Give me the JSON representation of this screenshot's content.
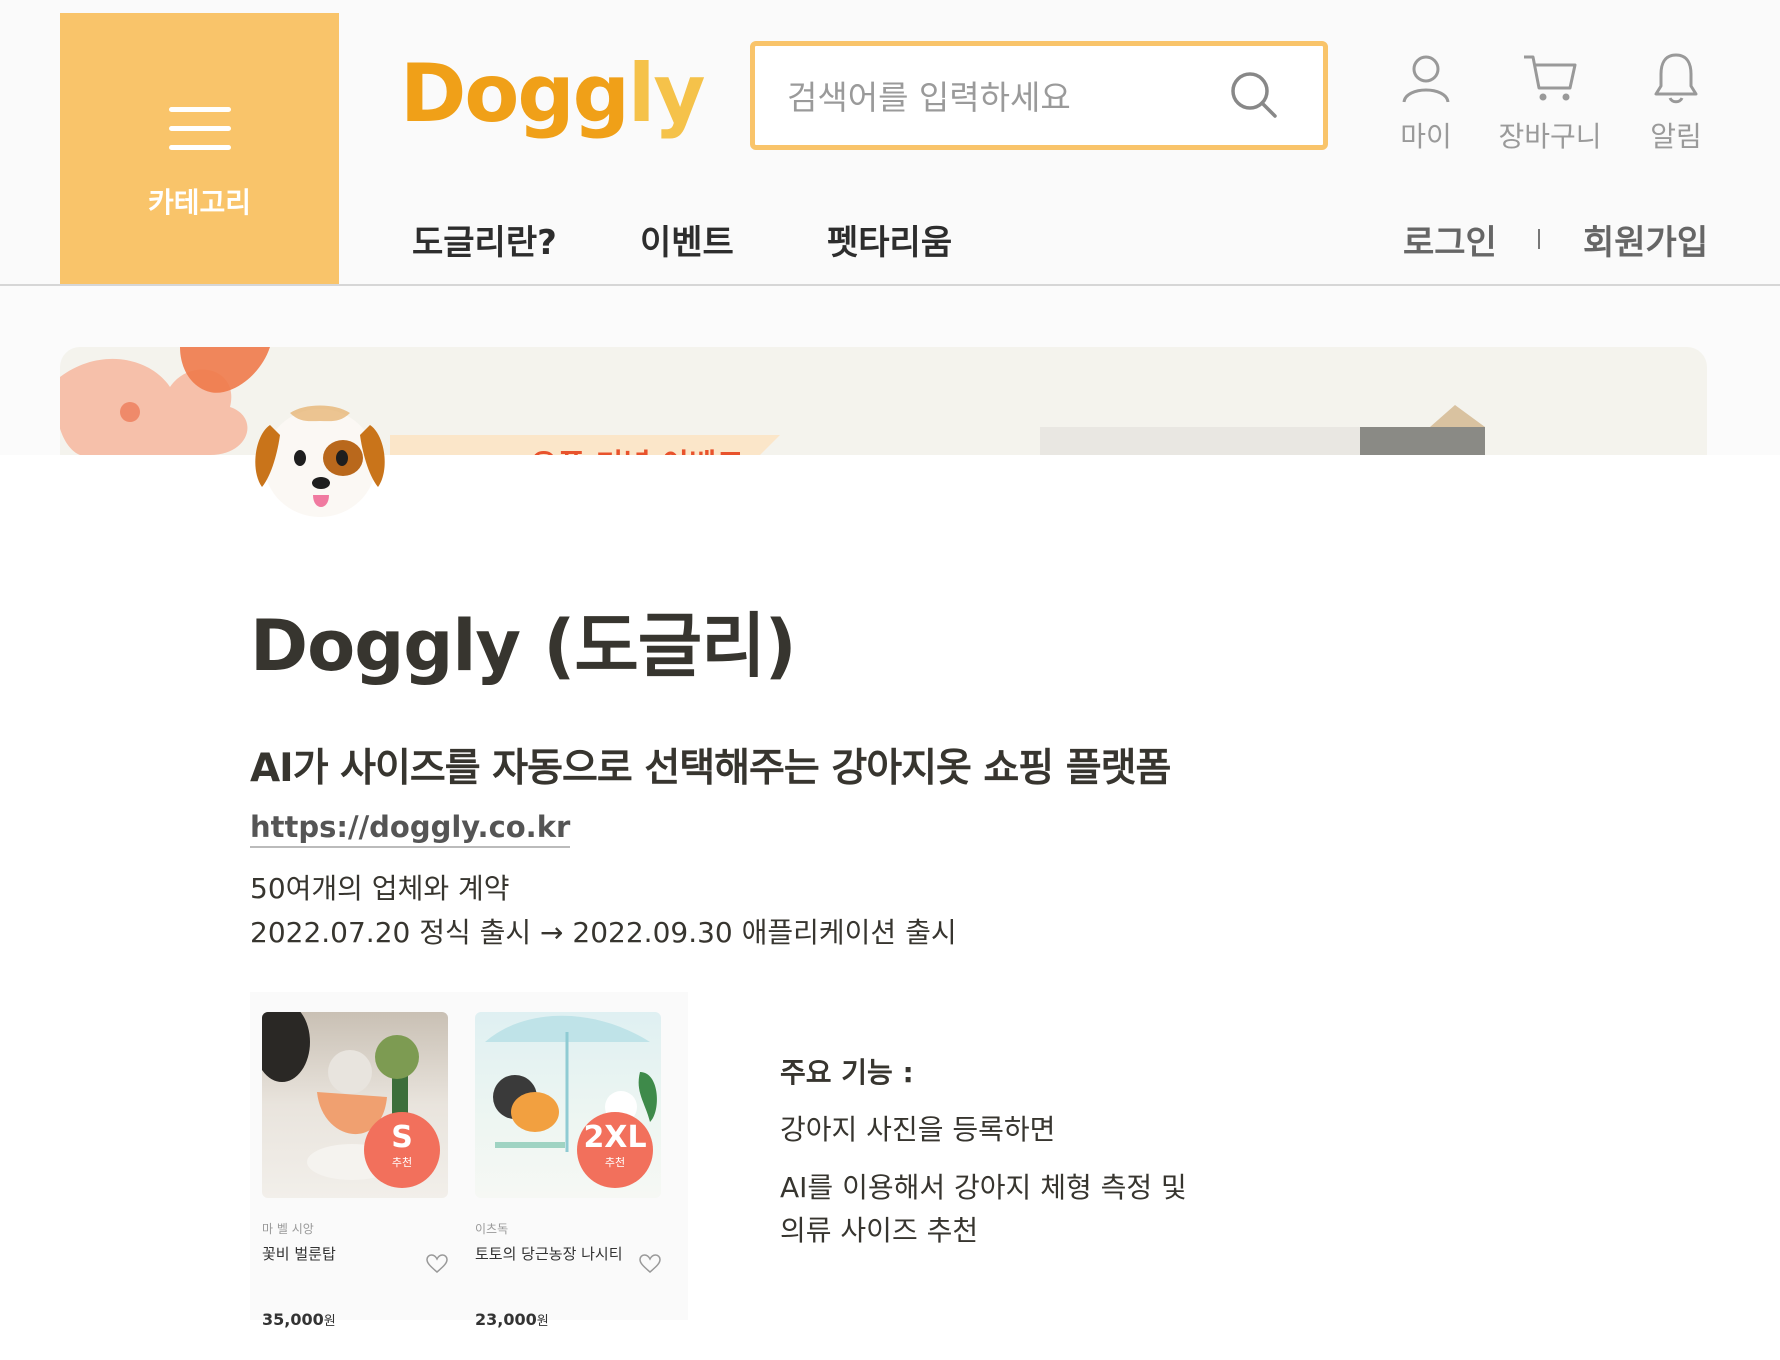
{
  "header": {
    "category_label": "카테고리",
    "logo": {
      "part1": "Dogg",
      "part2": "ly"
    },
    "search": {
      "placeholder": "검색어를 입력하세요"
    },
    "icons": [
      {
        "name": "user-icon",
        "label": "마이"
      },
      {
        "name": "cart-icon",
        "label": "장바구니"
      },
      {
        "name": "bell-icon",
        "label": "알림"
      }
    ],
    "nav": [
      "도글리란?",
      "이벤트",
      "펫타리움"
    ],
    "auth": {
      "login": "로그인",
      "signup": "회원가입"
    }
  },
  "banner": {
    "text": "오픈 기념 이벤트"
  },
  "page": {
    "title": "Doggly (도글리)",
    "subtitle": "AI가 사이즈를 자동으로 선택해주는 강아지옷 쇼핑 플랫폼",
    "url": "https://doggly.co.kr",
    "line1": "50여개의 업체와 계약",
    "line2": "2022.07.20 정식 출시 → 2022.09.30 애플리케이션 출시"
  },
  "products": [
    {
      "badge": "S",
      "badge_sub": "추천",
      "brand": "마 벨 시앙",
      "name": "꽃비 벌룬탑",
      "price": "35,000",
      "unit": "원"
    },
    {
      "badge": "2XL",
      "badge_sub": "추천",
      "brand": "이츠독",
      "name": "토토의 당근농장 나시티",
      "price": "23,000",
      "unit": "원"
    }
  ],
  "features": {
    "heading": "주요 기능 :",
    "line1": "강아지 사진을 등록하면",
    "line2": "AI를 이용해서 강아지 체형 측정 및",
    "line3": "의류 사이즈 추천"
  },
  "colors": {
    "accent": "#f9c46a",
    "logo_dark": "#f0a018",
    "logo_light": "#f5c24a",
    "badge": "#f2705c"
  }
}
